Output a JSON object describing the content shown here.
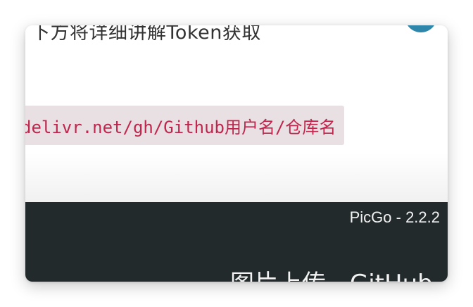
{
  "document": {
    "heading_fragment": "下方将详细讲解Token获取",
    "code_snippet": "delivr.net/gh/Github用户名/仓库名"
  },
  "footer": {
    "app_version_label": "PicGo - 2.2.2",
    "upload_title": "图片上传 - GitHub"
  },
  "colors": {
    "footer_background": "#222a2c",
    "code_text": "#c0264d",
    "code_background": "#e8e0e2",
    "avatar": "#2e86ab"
  },
  "icons": {
    "avatar": "avatar-circle-icon"
  }
}
